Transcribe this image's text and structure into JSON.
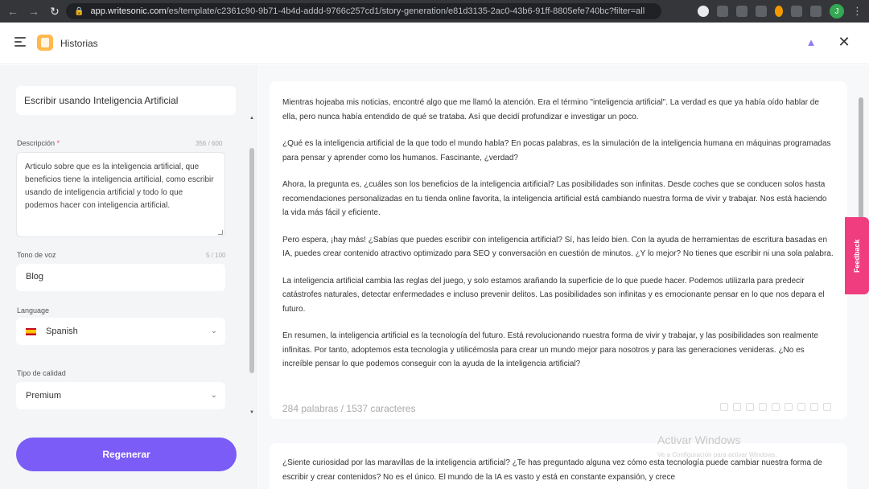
{
  "browser": {
    "url_host": "app.writesonic.com",
    "url_path": "/es/template/c2361c90-9b71-4b4d-addd-9766c257cd1/story-generation/e81d3135-2ac0-43b6-91ff-8805efe740bc?filter=all",
    "avatar_initial": "J"
  },
  "header": {
    "title": "Historias"
  },
  "left": {
    "doc_title": "Escribir usando Inteligencia Artificial",
    "description_label": "Descripción",
    "description_required": "*",
    "description_counter": "356 / 600",
    "description_value": "Articulo sobre que es la inteligencia artificial, que beneficios tiene la inteligencia artificial, como escribir usando de  inteligencia artificial y todo lo que podemos hacer con inteligencia artificial.",
    "tone_label": "Tono de voz",
    "tone_counter": "5 / 100",
    "tone_value": "Blog",
    "language_label": "Language",
    "language_value": "Spanish",
    "quality_label": "Tipo de calidad",
    "quality_value": "Premium",
    "regenerate_label": "Regenerar"
  },
  "output": {
    "paragraphs": [
      "Mientras hojeaba mis noticias, encontré algo que me llamó la atención. Era el término \"inteligencia artificial\". La verdad es que ya había oído hablar de ella, pero nunca había entendido de qué se trataba. Así que decidí profundizar e investigar un poco.",
      "¿Qué es la inteligencia artificial de la que todo el mundo habla? En pocas palabras, es la simulación de la inteligencia humana en máquinas programadas para pensar y aprender como los humanos. Fascinante, ¿verdad?",
      "Ahora, la pregunta es, ¿cuáles son los beneficios de la inteligencia artificial? Las posibilidades son infinitas. Desde coches que se conducen solos hasta recomendaciones personalizadas en tu tienda online favorita, la inteligencia artificial está cambiando nuestra forma de vivir y trabajar. Nos está haciendo la vida más fácil y eficiente.",
      "Pero espera, ¡hay más! ¿Sabías que puedes escribir con inteligencia artificial? Sí, has leído bien. Con la ayuda de herramientas de escritura basadas en IA, puedes crear contenido atractivo optimizado para SEO y conversación en cuestión de minutos. ¿Y lo mejor? No tienes que escribir ni una sola palabra.",
      "La inteligencia artificial cambia las reglas del juego, y solo estamos arañando la superficie de lo que puede hacer. Podemos utilizarla para predecir catástrofes naturales, detectar enfermedades e incluso prevenir delitos. Las posibilidades son infinitas y es emocionante pensar en lo que nos depara el futuro.",
      "En resumen, la inteligencia artificial es la tecnología del futuro. Está revolucionando nuestra forma de vivir y trabajar, y las posibilidades son realmente infinitas. Por tanto, adoptemos esta tecnología y utilicémosla para crear un mundo mejor para nosotros y para las generaciones venideras. ¿No es increíble pensar lo que podemos conseguir con la ayuda de la inteligencia artificial?"
    ],
    "meta": "284 palabras / 1537 caracteres",
    "second_card_text": "¿Siente curiosidad por las maravillas de la inteligencia artificial? ¿Te has preguntado alguna vez cómo esta tecnología puede cambiar nuestra forma de escribir y crear contenidos? No es el único. El mundo de la IA es vasto y está en constante expansión, y crece"
  },
  "watermark": {
    "title": "Activar Windows",
    "subtitle": "Ve a Configuración para activar Windows."
  },
  "feedback_label": "Feedback",
  "colors": {
    "accent": "#7b5cf6",
    "feedback": "#f03d7f"
  }
}
